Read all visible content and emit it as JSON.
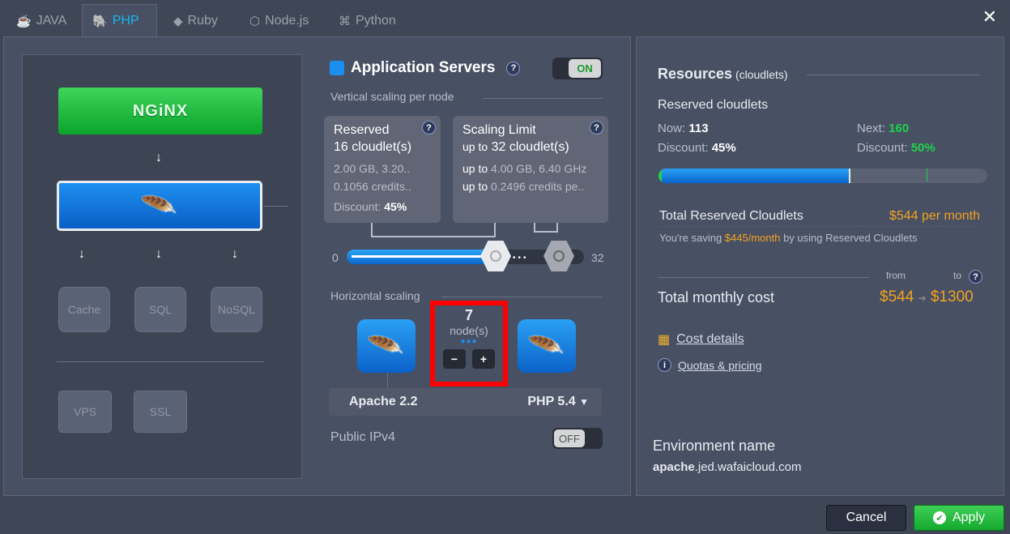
{
  "tabs": [
    {
      "label": "JAVA",
      "icon": "java-icon"
    },
    {
      "label": "PHP",
      "icon": "php-icon"
    },
    {
      "label": "Ruby",
      "icon": "ruby-icon"
    },
    {
      "label": "Node.js",
      "icon": "nodejs-icon"
    },
    {
      "label": "Python",
      "icon": "python-icon"
    }
  ],
  "topology": {
    "nginx": "NGiNX",
    "cache": "Cache",
    "sql": "SQL",
    "nosql": "NoSQL",
    "vps": "VPS",
    "ssl": "SSL"
  },
  "app": {
    "title": "Application Servers",
    "toggle": "ON",
    "vertical_label": "Vertical scaling per node",
    "reserved": {
      "title": "Reserved",
      "value": "16 cloudlet(s)",
      "line1": "2.00 GB, 3.20..",
      "line2": "0.1056 credits..",
      "discount_label": "Discount:",
      "discount": "45%"
    },
    "limit": {
      "title": "Scaling Limit",
      "prefix": "up to",
      "value": "32 cloudlet(s)",
      "line1": "4.00 GB, 6.40 GHz",
      "line2": "0.2496 credits pe.."
    },
    "slider": {
      "min": "0",
      "max": "32",
      "reserved": 16,
      "limit": 32
    },
    "horizontal_label": "Horizontal scaling",
    "nodes": "7",
    "nodes_label": "node(s)",
    "minus": "−",
    "plus": "+",
    "server": "Apache 2.2",
    "engine": "PHP 5.4",
    "ipv4_label": "Public IPv4",
    "ipv4_toggle": "OFF"
  },
  "resources": {
    "title": "Resources",
    "unit": "(cloudlets)",
    "reserved_label": "Reserved cloudlets",
    "now_label": "Now:",
    "now": "113",
    "next_label": "Next:",
    "next": "160",
    "discount_label": "Discount:",
    "discount_now": "45%",
    "discount_next": "50%",
    "progress": 0.58,
    "total_reserved_label": "Total Reserved Cloudlets",
    "total_reserved": "$544 per month",
    "saving_pre": "You're saving",
    "saving": "$445/month",
    "saving_post": "by using Reserved Cloudlets",
    "from": "from",
    "to": "to",
    "monthly_label": "Total monthly cost",
    "cost_from": "$544",
    "cost_to": "$1300",
    "cost_details": "Cost details",
    "quotas": "Quotas & pricing",
    "env_label": "Environment name",
    "env_bold": "apache",
    "env_rest": ".jed.wafaicloud.com"
  },
  "footer": {
    "cancel": "Cancel",
    "apply": "Apply"
  },
  "colors": {
    "accent": "#19b6f0",
    "orange": "#f4a21e",
    "green": "#1ed34a"
  }
}
